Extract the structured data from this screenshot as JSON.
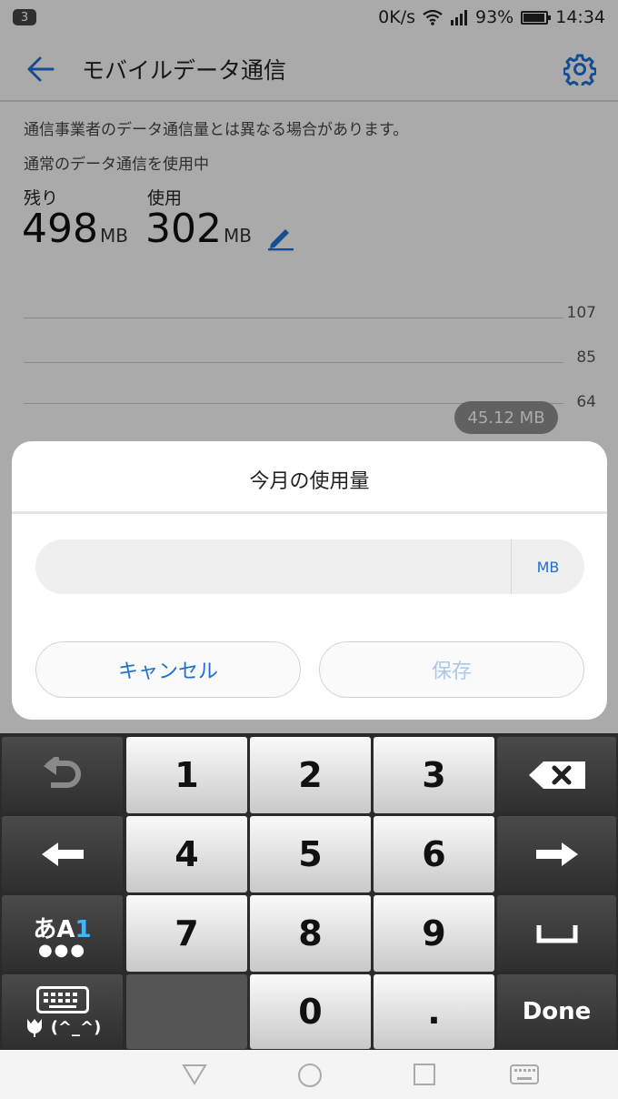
{
  "status_bar": {
    "notification_count": "3",
    "net_speed": "0K/s",
    "battery_percent": "93%",
    "time": "14:34",
    "icons": [
      "wifi-icon",
      "signal-icon",
      "battery-icon"
    ]
  },
  "app_bar": {
    "title": "モバイルデータ通信",
    "back_icon": "back-arrow-icon",
    "settings_icon": "gear-icon",
    "accent_color": "#1f6fd1"
  },
  "content": {
    "disclaimer": "通信事業者のデータ通信量とは異なる場合があります。",
    "plan_status": "通常のデータ通信を使用中",
    "remaining": {
      "label": "残り",
      "value": "498",
      "unit": "MB"
    },
    "used": {
      "label": "使用",
      "value": "302",
      "unit": "MB"
    },
    "edit_icon": "pencil-icon"
  },
  "chart": {
    "y_ticks": [
      "107",
      "85",
      "64"
    ],
    "tooltip": "45.12 MB"
  },
  "dialog": {
    "title": "今月の使用量",
    "input_value": "",
    "input_placeholder": "",
    "unit": "MB",
    "cancel_label": "キャンセル",
    "save_label": "保存"
  },
  "keyboard": {
    "digits": [
      "1",
      "2",
      "3",
      "4",
      "5",
      "6",
      "7",
      "8",
      "9",
      "0",
      "."
    ],
    "mode_label_kana": "あ",
    "mode_label_alpha": "A",
    "mode_label_num": "1",
    "emoji_label": "(^_^)",
    "done_label": "Done"
  },
  "nav_bar": {
    "icons": [
      "back-triangle-icon",
      "home-circle-icon",
      "recents-square-icon",
      "keyboard-icon"
    ]
  }
}
